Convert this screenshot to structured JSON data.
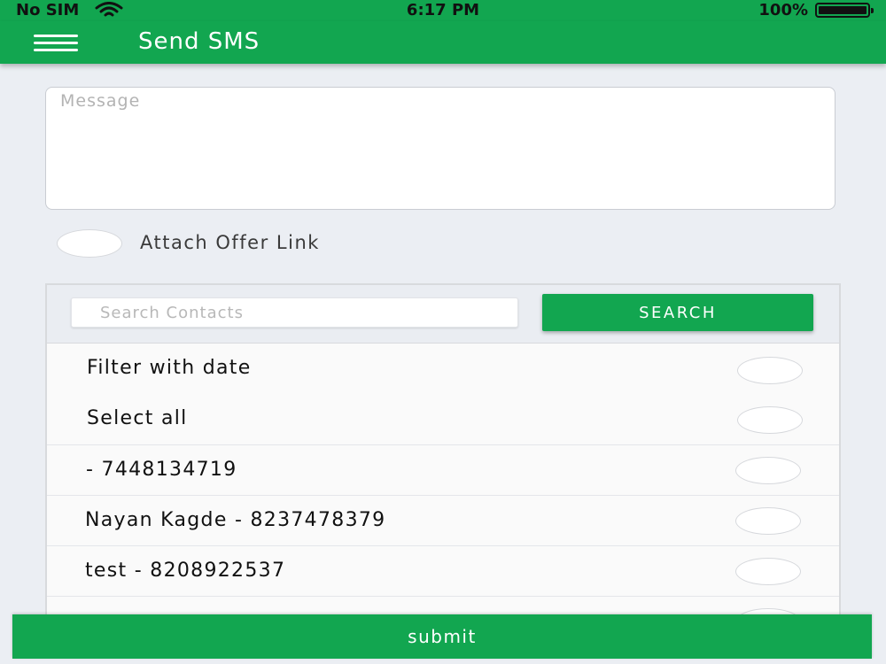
{
  "status_bar": {
    "carrier": "No SIM",
    "time": "6:17 PM",
    "battery": "100%"
  },
  "app_bar": {
    "menu_icon": "hamburger-menu-icon",
    "title": "Send SMS"
  },
  "message": {
    "placeholder": "Message",
    "value": ""
  },
  "attach_offer": {
    "label": "Attach Offer Link",
    "checked": false
  },
  "search": {
    "placeholder": "Search Contacts",
    "button_label": "SEARCH"
  },
  "options": {
    "filter_with_date": "Filter with date",
    "select_all": "Select all"
  },
  "contacts": [
    {
      "label": " - 7448134719",
      "selected": false
    },
    {
      "label": "Nayan Kagde - 8237478379",
      "selected": false
    },
    {
      "label": "test - 8208922537",
      "selected": false
    }
  ],
  "submit_label": "submit",
  "colors": {
    "primary": "#12a650",
    "background": "#ebeef3"
  }
}
